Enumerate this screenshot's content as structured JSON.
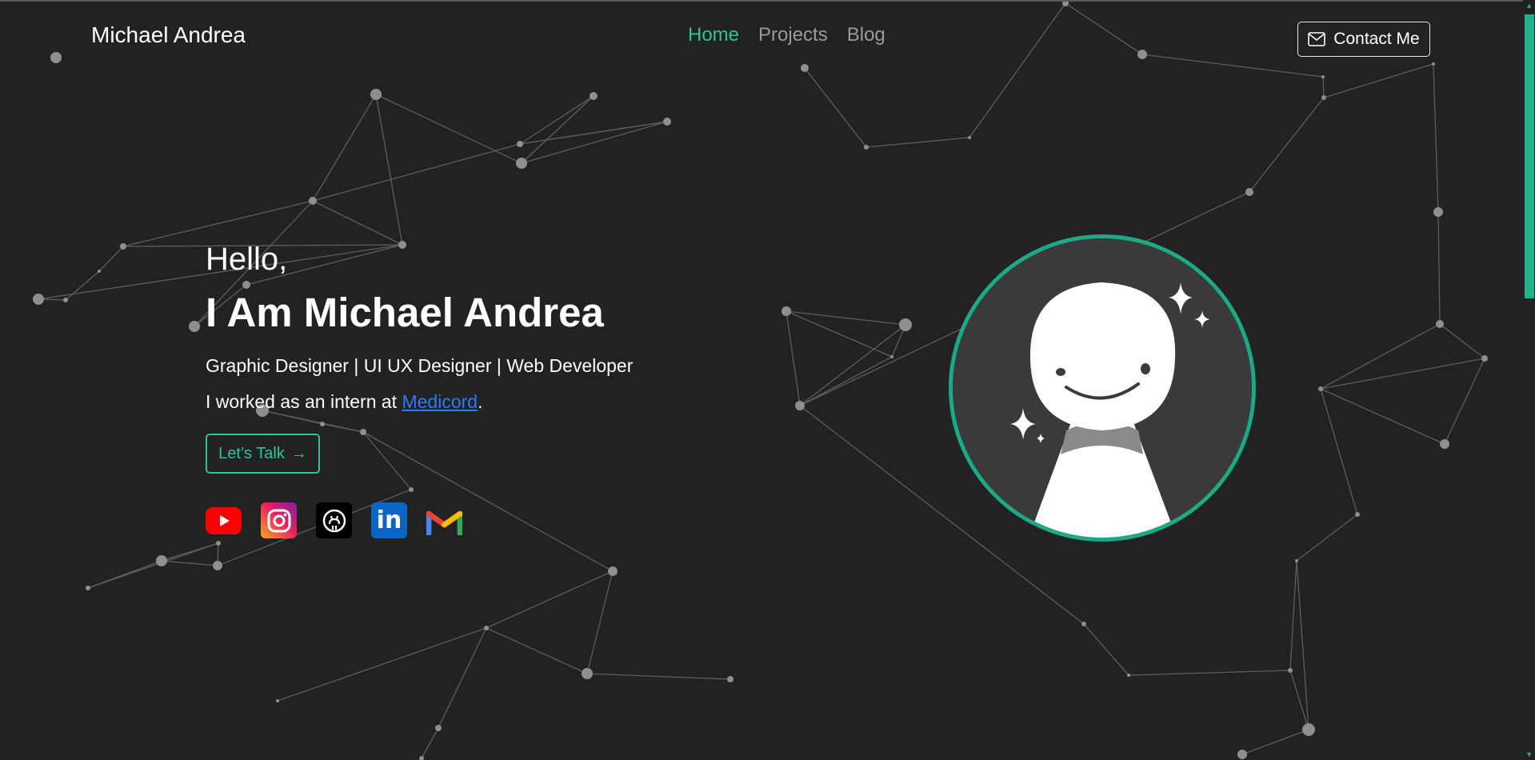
{
  "header": {
    "brand": "Michael Andrea",
    "nav": [
      {
        "label": "Home",
        "active": true
      },
      {
        "label": "Projects",
        "active": false
      },
      {
        "label": "Blog",
        "active": false
      }
    ],
    "contact_label": "Contact Me"
  },
  "hero": {
    "greeting": "Hello,",
    "name": "I Am Michael Andrea",
    "roles": "Graphic Designer | UI UX Designer | Web Developer",
    "intern_prefix": "I worked as an intern at ",
    "intern_company": "Medicord",
    "intern_suffix": ".",
    "cta_label": "Let’s Talk",
    "cta_arrow": "→"
  },
  "socials": [
    {
      "name": "youtube",
      "icon": "youtube-icon",
      "color": "#ff0000"
    },
    {
      "name": "instagram",
      "icon": "instagram-icon",
      "color": "#e91e63"
    },
    {
      "name": "github",
      "icon": "github-icon",
      "color": "#000000"
    },
    {
      "name": "linkedin",
      "icon": "linkedin-icon",
      "color": "#0a66c2",
      "glyph": "in"
    },
    {
      "name": "gmail",
      "icon": "gmail-icon",
      "color": "#ea4335"
    }
  ],
  "colors": {
    "background": "#222222",
    "accent": "#2bc49b",
    "link": "#2a7bff",
    "nav_inactive": "#9a9a9a"
  }
}
